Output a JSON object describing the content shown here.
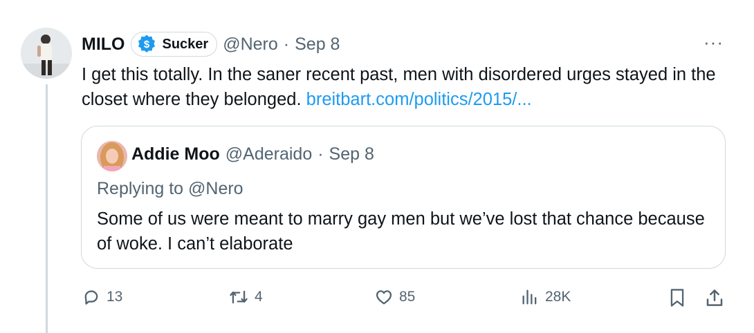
{
  "tweet": {
    "author_name": "MILO",
    "badge": {
      "label": "Sucker",
      "icon": "dollar-badge-icon",
      "color": "#1d9bf0"
    },
    "handle": "@Nero",
    "separator": "·",
    "date": "Sep 8",
    "more": "···",
    "text": "I get this totally. In the saner recent past, men with disordered urges stayed in the closet where they belonged.",
    "link": "breitbart.com/politics/2015/..."
  },
  "quote": {
    "author_name": "Addie Moo",
    "handle": "@Aderaido",
    "separator": "·",
    "date": "Sep 8",
    "replying_label": "Replying to @Nero",
    "text": "Some of us were meant to marry gay men but we’ve lost that chance because of woke. I can’t elaborate"
  },
  "actions": {
    "replies": "13",
    "reposts": "4",
    "likes": "85",
    "views": "28K",
    "icons": [
      "reply-icon",
      "repost-icon",
      "like-icon",
      "views-icon",
      "bookmark-icon",
      "share-icon"
    ]
  },
  "colors": {
    "link": "#1d9bf0",
    "muted": "#536471",
    "text": "#0f1419",
    "border": "#cfd9de"
  }
}
